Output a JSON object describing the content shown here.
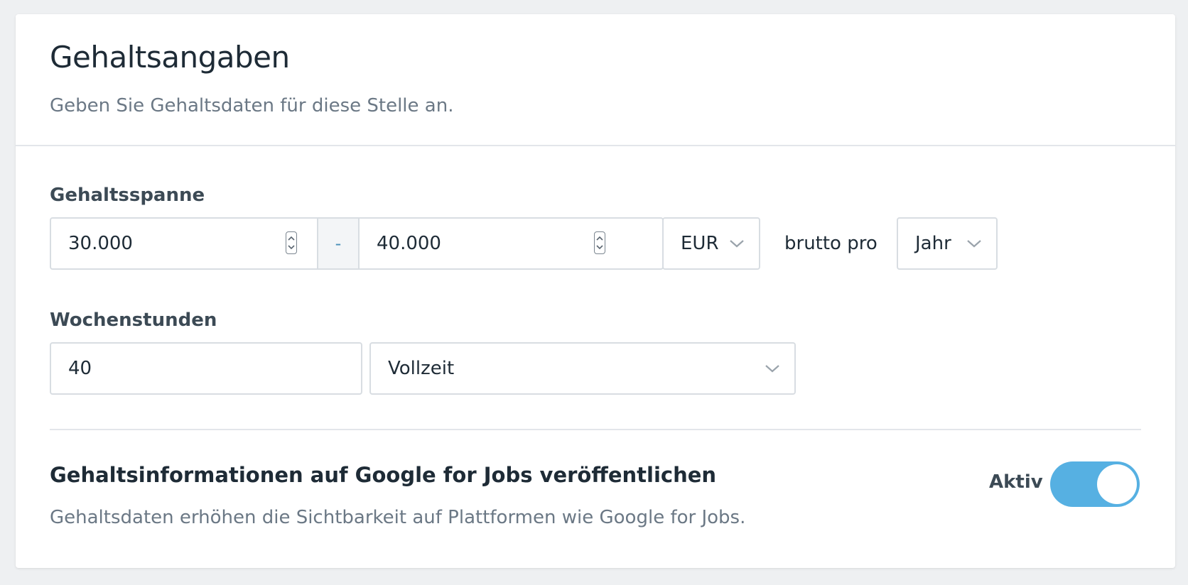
{
  "header": {
    "title": "Gehaltsangaben",
    "subtitle": "Geben Sie Gehaltsdaten für diese Stelle an."
  },
  "salary_range": {
    "label": "Gehaltsspanne",
    "min_value": "30.000",
    "separator": "-",
    "max_value": "40.000",
    "currency": "EUR",
    "gross_per_text": "brutto pro",
    "period": "Jahr"
  },
  "weekly_hours": {
    "label": "Wochenstunden",
    "value": "40",
    "employment_type": "Vollzeit"
  },
  "publish": {
    "title": "Gehaltsinformationen auf Google for Jobs veröffentlichen",
    "description": "Gehaltsdaten erhöhen die Sichtbarkeit auf Plattformen wie Google for Jobs.",
    "toggle_label": "Aktiv",
    "toggle_on": true
  },
  "colors": {
    "toggle_active": "#56b0e2",
    "background": "#eef0f2"
  }
}
